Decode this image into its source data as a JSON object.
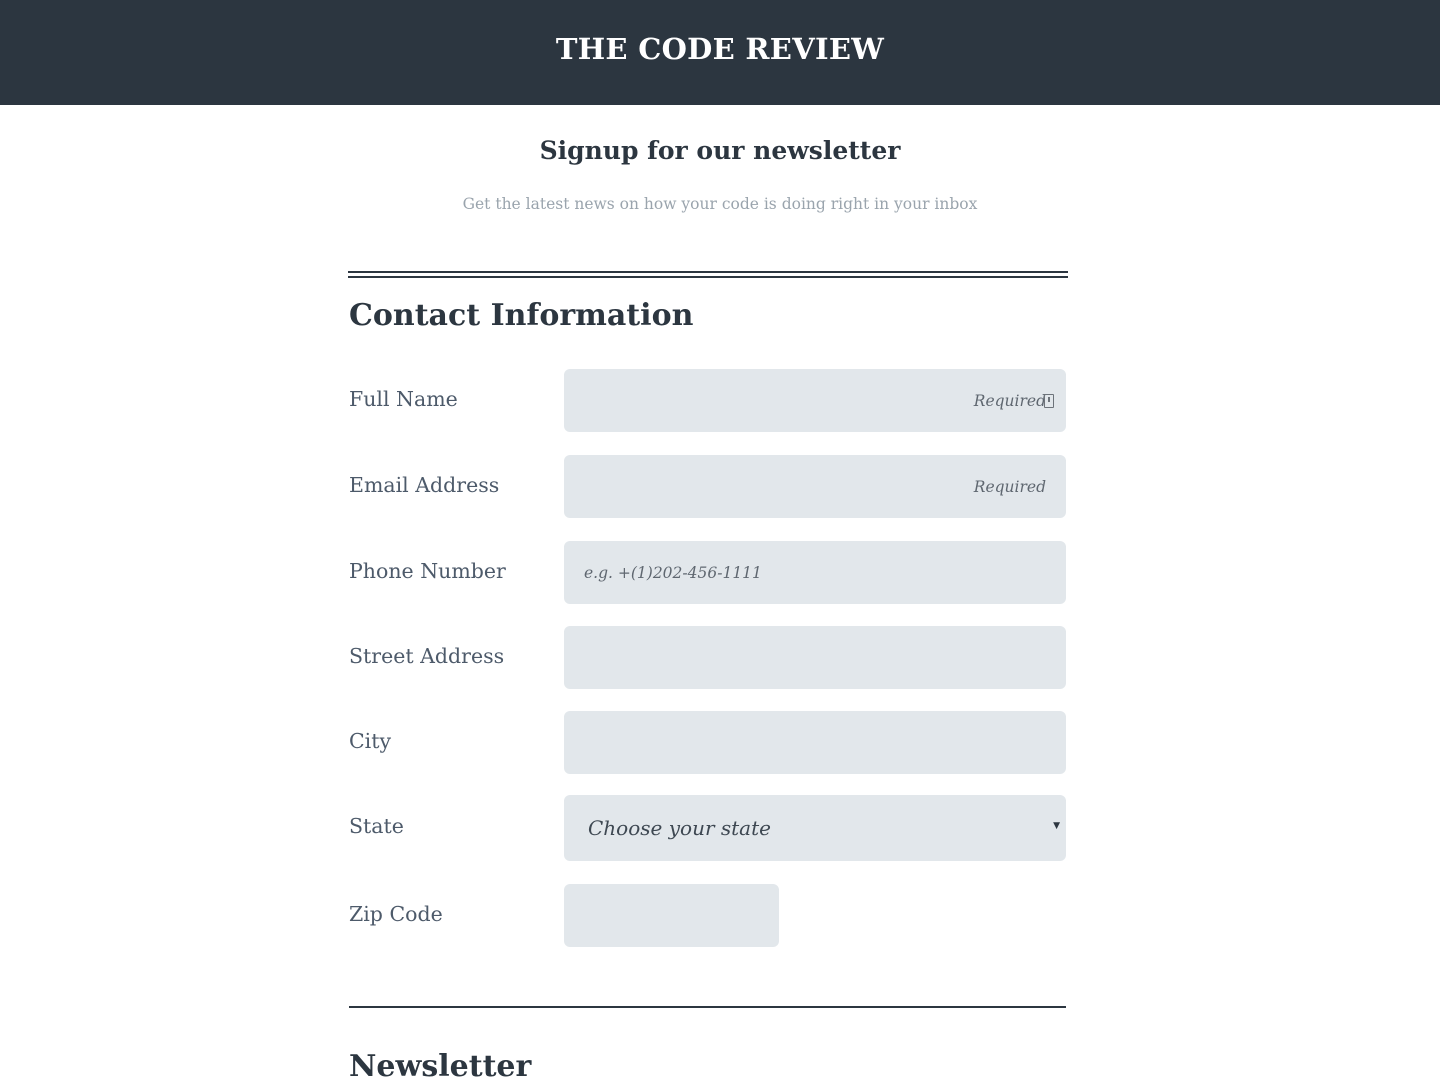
{
  "header": {
    "title": "THE CODE REVIEW"
  },
  "intro": {
    "title": "Signup for our newsletter",
    "subtitle": "Get the latest news on how your code is doing right in your inbox"
  },
  "sections": {
    "contact": {
      "heading": "Contact Information",
      "fields": {
        "full_name": {
          "label": "Full Name",
          "value": "",
          "placeholder": "Required"
        },
        "email": {
          "label": "Email Address",
          "value": "",
          "placeholder": "Required"
        },
        "phone": {
          "label": "Phone Number",
          "value": "",
          "placeholder": "e.g. +(1)202-456-1111"
        },
        "street": {
          "label": "Street Address",
          "value": ""
        },
        "city": {
          "label": "City",
          "value": ""
        },
        "state": {
          "label": "State",
          "selected": "Choose your state"
        },
        "zip": {
          "label": "Zip Code",
          "value": ""
        }
      }
    },
    "newsletter": {
      "heading": "Newsletter"
    }
  },
  "icons": {
    "autofill": "contact-card-icon",
    "select_caret": "caret-down-icon"
  },
  "colors": {
    "header_bg": "#2c3640",
    "field_bg": "#e2e7eb",
    "label_text": "#4d5a6a",
    "subtitle_text": "#9aa4ad"
  }
}
